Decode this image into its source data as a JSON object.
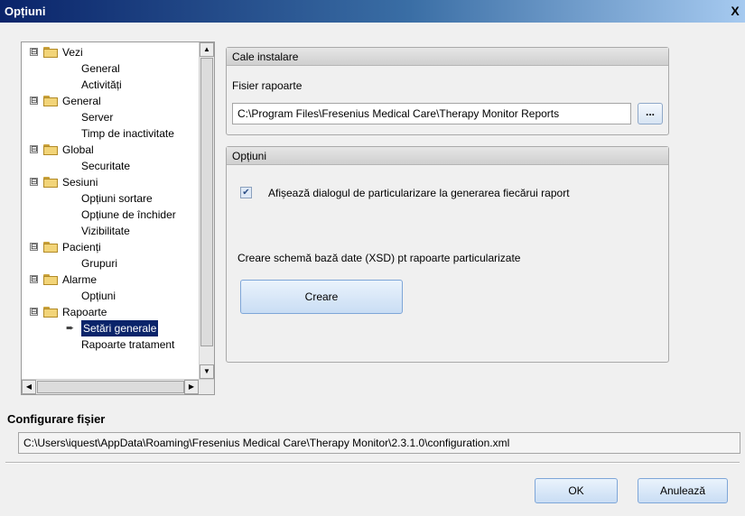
{
  "window": {
    "title": "Opțiuni",
    "close_glyph": "X"
  },
  "tree": {
    "items": [
      {
        "label": "Vezi",
        "expander": "⊟"
      },
      {
        "label": "General"
      },
      {
        "label": "Activități"
      },
      {
        "label": "General",
        "expander": "⊟"
      },
      {
        "label": "Server"
      },
      {
        "label": "Timp de inactivitate"
      },
      {
        "label": "Global",
        "expander": "⊟"
      },
      {
        "label": "Securitate"
      },
      {
        "label": "Sesiuni",
        "expander": "⊟"
      },
      {
        "label": "Opțiuni sortare"
      },
      {
        "label": "Opțiune de închider"
      },
      {
        "label": "Vizibilitate"
      },
      {
        "label": "Pacienți",
        "expander": "⊟"
      },
      {
        "label": "Grupuri"
      },
      {
        "label": "Alarme",
        "expander": "⊟"
      },
      {
        "label": "Opțiuni"
      },
      {
        "label": "Rapoarte",
        "expander": "⊟"
      },
      {
        "label": "Setări generale",
        "selected": true
      },
      {
        "label": "Rapoarte tratament"
      }
    ],
    "arrow_icon": "➨",
    "scroll_up_glyph": "▲",
    "scroll_down_glyph": "▼",
    "scroll_left_glyph": "◀",
    "scroll_right_glyph": "▶"
  },
  "install_path": {
    "header": "Cale instalare",
    "label": "Fisier rapoarte",
    "value": "C:\\Program Files\\Fresenius Medical Care\\Therapy Monitor Reports",
    "browse_label": "..."
  },
  "options": {
    "header": "Opțiuni",
    "checkbox_label": "Afișează dialogul de particularizare la generarea fiecărui raport",
    "checkbox_checked": true,
    "schema_label": "Creare schemă bază date (XSD) pt rapoarte particularizate",
    "create_button": "Creare"
  },
  "config_file": {
    "label": "Configurare fișier",
    "value": "C:\\Users\\iquest\\AppData\\Roaming\\Fresenius Medical Care\\Therapy Monitor\\2.3.1.0\\configuration.xml"
  },
  "footer": {
    "ok_label": "OK",
    "cancel_label": "Anulează"
  },
  "colors": {
    "titlebar_start": "#0a246a",
    "selection": "#0a246a",
    "button_border": "#7ea6d8"
  }
}
